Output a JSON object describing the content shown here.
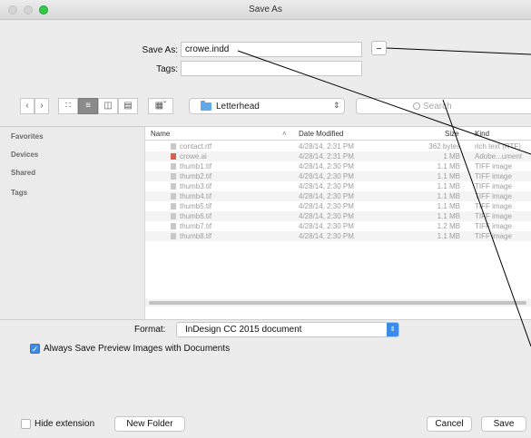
{
  "window": {
    "title": "Save As"
  },
  "form": {
    "save_as_label": "Save As:",
    "save_as_value": "crowe.indd",
    "tags_label": "Tags:",
    "tags_value": ""
  },
  "toolbar": {
    "back_icon": "chevron-left-icon",
    "forward_icon": "chevron-right-icon",
    "location": "Letterhead",
    "search_placeholder": "Search"
  },
  "sidebar": {
    "items": [
      {
        "label": "Favorites"
      },
      {
        "label": "Devices"
      },
      {
        "label": "Shared"
      },
      {
        "label": "Tags"
      }
    ]
  },
  "file_list": {
    "headers": {
      "name": "Name",
      "date": "Date Modified",
      "size": "Size",
      "kind": "Kind"
    },
    "rows": [
      {
        "name": "contact.rtf",
        "date": "4/28/14, 2:31 PM",
        "size": "362 bytes",
        "kind": "rich text (RTF)"
      },
      {
        "name": "crowe.ai",
        "date": "4/28/14, 2:31 PM",
        "size": "1 MB",
        "kind": "Adobe...ument"
      },
      {
        "name": "thumb1.tif",
        "date": "4/28/14, 2:30 PM",
        "size": "1.1 MB",
        "kind": "TIFF image"
      },
      {
        "name": "thumb2.tif",
        "date": "4/28/14, 2:30 PM",
        "size": "1.1 MB",
        "kind": "TIFF image"
      },
      {
        "name": "thumb3.tif",
        "date": "4/28/14, 2:30 PM",
        "size": "1.1 MB",
        "kind": "TIFF image"
      },
      {
        "name": "thumb4.tif",
        "date": "4/28/14, 2:30 PM",
        "size": "1.1 MB",
        "kind": "TIFF image"
      },
      {
        "name": "thumb5.tif",
        "date": "4/28/14, 2:30 PM",
        "size": "1.1 MB",
        "kind": "TIFF image"
      },
      {
        "name": "thumb6.tif",
        "date": "4/28/14, 2:30 PM",
        "size": "1.1 MB",
        "kind": "TIFF image"
      },
      {
        "name": "thumb7.tif",
        "date": "4/28/14, 2:30 PM",
        "size": "1.2 MB",
        "kind": "TIFF image"
      },
      {
        "name": "thumb8.tif",
        "date": "4/28/14, 2:30 PM",
        "size": "1.1 MB",
        "kind": "TIFF image"
      }
    ]
  },
  "options": {
    "format_label": "Format:",
    "format_value": "InDesign CC 2015 document",
    "always_save_preview_label": "Always Save Preview Images with Documents",
    "always_save_preview_checked": true,
    "hide_extension_label": "Hide extension",
    "hide_extension_checked": false
  },
  "buttons": {
    "new_folder": "New Folder",
    "cancel": "Cancel",
    "save": "Save"
  },
  "colors": {
    "accent": "#3d8be9",
    "zoom_button": "#34c84a"
  }
}
